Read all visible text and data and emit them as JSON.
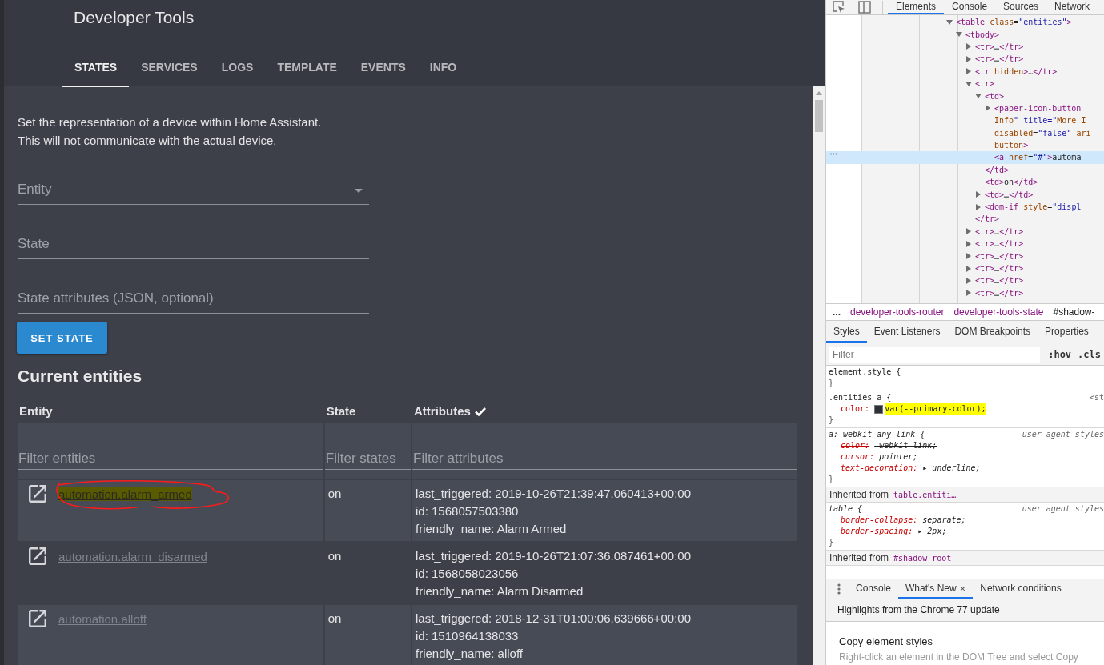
{
  "app": {
    "title": "Developer Tools",
    "tabs": [
      {
        "label": "STATES",
        "selected": true
      },
      {
        "label": "SERVICES",
        "selected": false
      },
      {
        "label": "LOGS",
        "selected": false
      },
      {
        "label": "TEMPLATE",
        "selected": false
      },
      {
        "label": "EVENTS",
        "selected": false
      },
      {
        "label": "INFO",
        "selected": false
      }
    ],
    "description": [
      "Set the representation of a device within Home Assistant.",
      "This will not communicate with the actual device."
    ],
    "fields": [
      {
        "placeholder": "Entity",
        "kind": "dropdown"
      },
      {
        "placeholder": "State",
        "kind": "text"
      },
      {
        "placeholder": "State attributes (JSON, optional)",
        "kind": "text"
      }
    ],
    "button": "SET STATE",
    "heading": "Current entities",
    "table": {
      "columns": [
        {
          "label": "Entity",
          "checked": false
        },
        {
          "label": "State",
          "checked": false
        },
        {
          "label": "Attributes",
          "checked": true
        }
      ],
      "filters": [
        {
          "placeholder": "Filter entities"
        },
        {
          "placeholder": "Filter states"
        },
        {
          "placeholder": "Filter attributes"
        }
      ],
      "rows": [
        {
          "entity": "automation.alarm_armed",
          "state": "on",
          "attributes": [
            "last_triggered: 2019-10-26T21:39:47.060413+00:00",
            "id: 1568057503380",
            "friendly_name: Alarm Armed"
          ],
          "highlighted": true,
          "circled": true
        },
        {
          "entity": "automation.alarm_disarmed",
          "state": "on",
          "attributes": [
            "last_triggered: 2019-10-26T21:07:36.087461+00:00",
            "id: 1568058023056",
            "friendly_name: Alarm Disarmed"
          ],
          "highlighted": false,
          "circled": false
        },
        {
          "entity": "automation.alloff",
          "state": "on",
          "attributes": [
            "last_triggered: 2018-12-31T01:00:06.639666+00:00",
            "id: 1510964138033",
            "friendly_name: alloff"
          ],
          "highlighted": false,
          "circled": false
        }
      ]
    }
  },
  "devtools": {
    "tabs": [
      {
        "label": "Elements",
        "selected": true
      },
      {
        "label": "Console",
        "selected": false
      },
      {
        "label": "Sources",
        "selected": false
      },
      {
        "label": "Network",
        "selected": false
      }
    ],
    "dom_tree": [
      {
        "kind": "element",
        "text": "<table class=\"entities\">",
        "expanded": true,
        "selected": false,
        "children": [
          {
            "kind": "element",
            "text": "<tbody>",
            "expanded": true,
            "selected": false,
            "children": [
              {
                "kind": "element",
                "text": "<tr>…</tr>",
                "expanded": false,
                "selected": false
              },
              {
                "kind": "element",
                "text": "<tr>…</tr>",
                "expanded": false,
                "selected": false
              },
              {
                "kind": "element",
                "text": "<tr hidden>…</tr>",
                "expanded": false,
                "selected": false
              },
              {
                "kind": "element",
                "text": "<tr>",
                "expanded": true,
                "selected": false,
                "close": "</tr>",
                "children": [
                  {
                    "kind": "element",
                    "text": "<td>",
                    "expanded": true,
                    "selected": false,
                    "close": "</td>",
                    "children": [
                      {
                        "kind": "element",
                        "text": "<paper-icon-button",
                        "expanded": false,
                        "selected": false,
                        "wrap": [
                          "Info\" title=\"More I",
                          "disabled=\"false\" ari",
                          "button>"
                        ]
                      },
                      {
                        "kind": "text",
                        "text": "<a href=\"#\">automa",
                        "selected": true,
                        "marker": "•••"
                      }
                    ]
                  },
                  {
                    "kind": "text",
                    "text": "<td>on</td>",
                    "selected": false
                  },
                  {
                    "kind": "element",
                    "text": "<td>…</td>",
                    "expanded": false,
                    "selected": false
                  },
                  {
                    "kind": "element",
                    "text": "<dom-if style=\"displ",
                    "expanded": false,
                    "selected": false
                  }
                ]
              },
              {
                "kind": "element",
                "text": "<tr>…</tr>",
                "expanded": false,
                "selected": false
              },
              {
                "kind": "element",
                "text": "<tr>…</tr>",
                "expanded": false,
                "selected": false
              },
              {
                "kind": "element",
                "text": "<tr>…</tr>",
                "expanded": false,
                "selected": false
              },
              {
                "kind": "element",
                "text": "<tr>…</tr>",
                "expanded": false,
                "selected": false
              },
              {
                "kind": "element",
                "text": "<tr>…</tr>",
                "expanded": false,
                "selected": false
              },
              {
                "kind": "element",
                "text": "<tr>…</tr>",
                "expanded": false,
                "selected": false
              }
            ]
          }
        ]
      }
    ],
    "breadcrumbs": [
      {
        "label": "...",
        "kind": "more"
      },
      {
        "label": "developer-tools-router",
        "kind": "element"
      },
      {
        "label": "developer-tools-state",
        "kind": "element"
      },
      {
        "label": "#shadow-",
        "kind": "shadow"
      }
    ],
    "style_tabs": [
      {
        "label": "Styles",
        "selected": true
      },
      {
        "label": "Event Listeners",
        "selected": false
      },
      {
        "label": "DOM Breakpoints",
        "selected": false
      },
      {
        "label": "Properties",
        "selected": false
      }
    ],
    "filter": {
      "placeholder": "Filter"
    },
    "toggles": [
      ":hov",
      ".cls"
    ],
    "rules": [
      {
        "kind": "rule",
        "user_agent": false,
        "open": "element.style {",
        "close": "}"
      },
      {
        "kind": "rule",
        "user_agent": false,
        "open": ".entities a {",
        "source": "<st",
        "close": "}",
        "declarations": [
          {
            "property": "color:",
            "value": "var(--primary-color);",
            "color": "#2e3036",
            "overridden": false,
            "highlighted": true
          }
        ]
      },
      {
        "kind": "rule",
        "user_agent": true,
        "open": "a:-webkit-any-link {",
        "source": "user agent styles",
        "close": "}",
        "declarations": [
          {
            "property": "color:",
            "value": "-webkit-link;",
            "overridden": true,
            "highlighted": false
          },
          {
            "property": "cursor:",
            "value": "pointer;",
            "overridden": false,
            "highlighted": false
          },
          {
            "property": "text-decoration:",
            "value": "▸ underline;",
            "overridden": false,
            "highlighted": false
          }
        ]
      },
      {
        "kind": "inherited",
        "label": "Inherited from",
        "ref": "table.entiti…"
      },
      {
        "kind": "rule",
        "user_agent": true,
        "open": "table {",
        "source": "user agent styles",
        "close": "}",
        "declarations": [
          {
            "property": "border-collapse:",
            "value": "separate;",
            "overridden": false,
            "highlighted": false
          },
          {
            "property": "border-spacing:",
            "value": "▸ 2px;",
            "overridden": false,
            "highlighted": false
          }
        ]
      },
      {
        "kind": "inherited",
        "label": "Inherited from",
        "ref": "#shadow-root"
      }
    ],
    "drawer": {
      "tabs": [
        {
          "label": "Console",
          "selected": false
        },
        {
          "label": "What's New",
          "selected": true,
          "close": "×"
        },
        {
          "label": "Network conditions",
          "selected": false
        }
      ],
      "banner": "Highlights from the Chrome 77 update",
      "article": {
        "title": "Copy element styles",
        "text": "Right-click an element in the DOM Tree and select Copy"
      }
    }
  }
}
